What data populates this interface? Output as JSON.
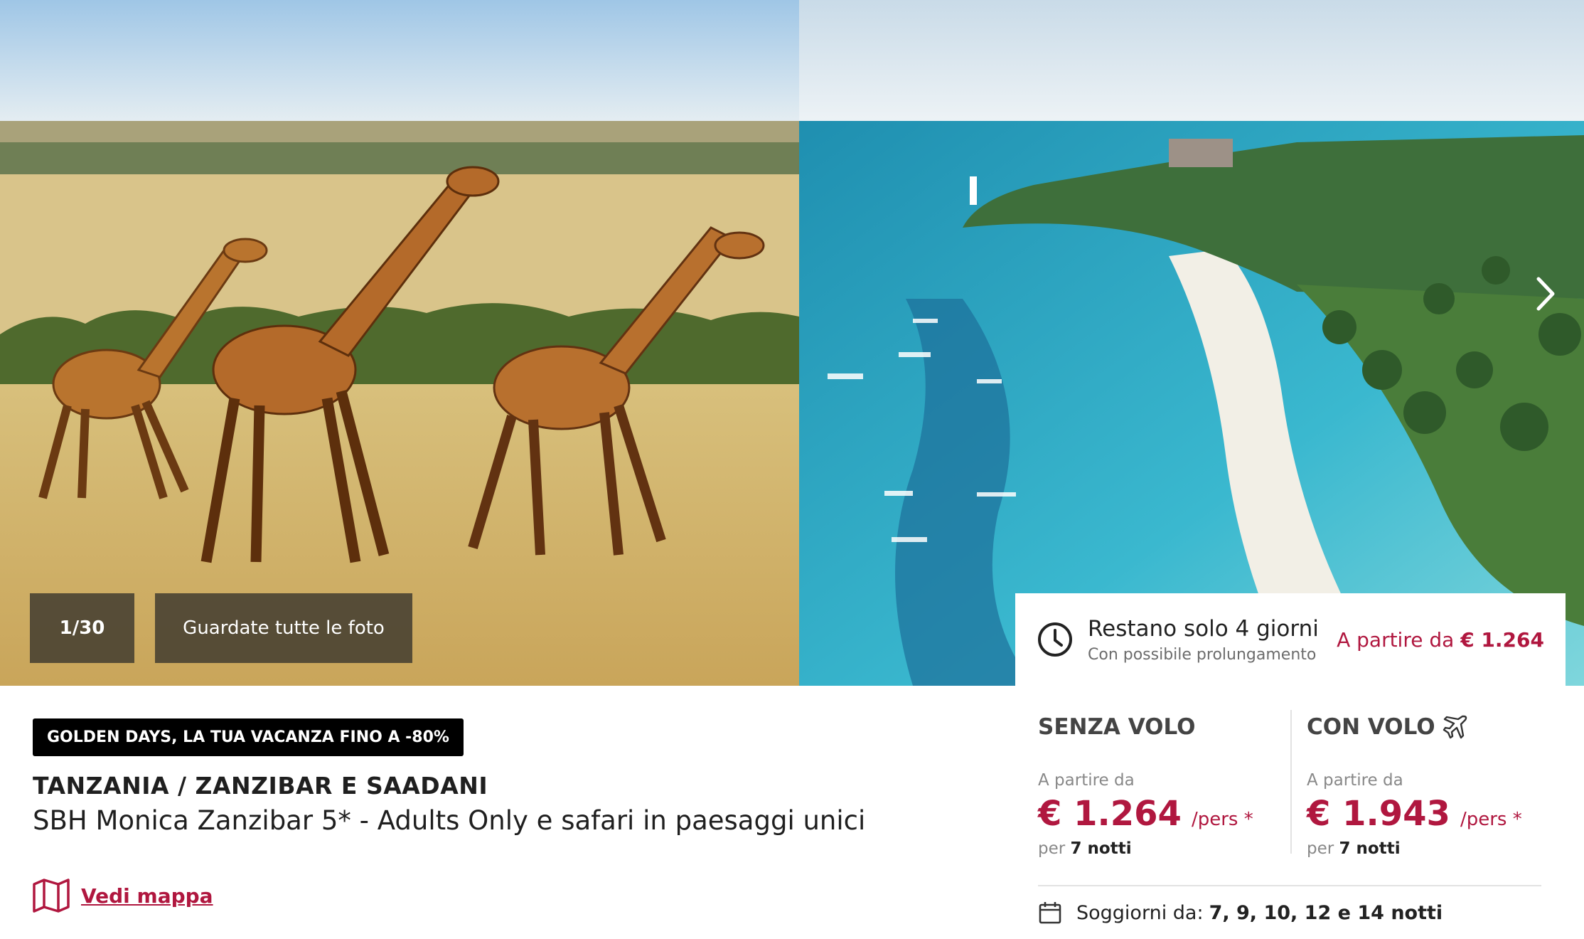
{
  "gallery": {
    "counter": "1/30",
    "all_photos_label": "Guardate tutte le foto",
    "left_photo_subject": "giraffes-savanna",
    "right_photo_subject": "zanzibar-beach-aerial",
    "next_icon": "chevron-right-icon"
  },
  "availability": {
    "title": "Restano solo 4 giorni",
    "subtitle": "Con possibile prolungamento",
    "from_prefix": "A partire da",
    "from_price": "€ 1.264",
    "icon": "clock-icon"
  },
  "offer": {
    "promo": "GOLDEN DAYS, LA TUA VACANZA FINO A -80%",
    "destination": "TANZANIA / ZANZIBAR E SAADANI",
    "hotel": "SBH Monica Zanzibar 5* - Adults Only e safari in paesaggi unici",
    "map_label": "Vedi mappa",
    "map_icon": "map-icon"
  },
  "pricing": {
    "no_flight": {
      "title": "SENZA VOLO",
      "from_label": "A partire da",
      "price": "€ 1.264",
      "per": "/pers *",
      "nights_prefix": "per",
      "nights": "7 notti"
    },
    "with_flight": {
      "title": "CON VOLO",
      "icon": "plane-icon",
      "from_label": "A partire da",
      "price": "€ 1.943",
      "per": "/pers *",
      "nights_prefix": "per",
      "nights": "7 notti"
    },
    "stays_label": "Soggiorni da:",
    "stays_value": "7, 9, 10, 12 e 14 notti",
    "stays_icon": "calendar-icon"
  },
  "colors": {
    "accent": "#b0173f",
    "overlay": "#423c30",
    "banner": "#000000"
  }
}
